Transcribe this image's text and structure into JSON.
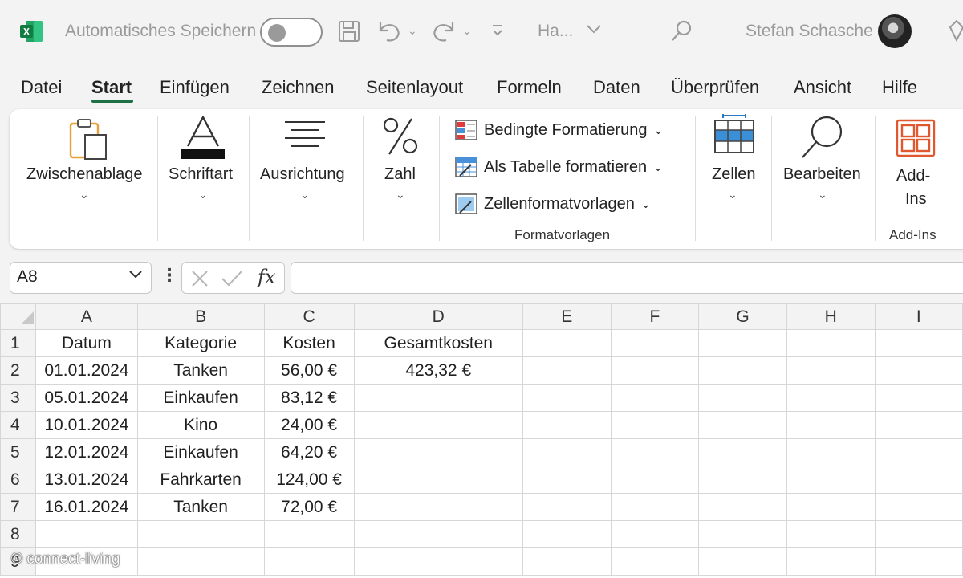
{
  "titlebar": {
    "autosave_label": "Automatisches Speichern",
    "doc_name": "Ha...",
    "user_name": "Stefan Schasche"
  },
  "tabs": [
    {
      "label": "Datei"
    },
    {
      "label": "Start"
    },
    {
      "label": "Einfügen"
    },
    {
      "label": "Zeichnen"
    },
    {
      "label": "Seitenlayout"
    },
    {
      "label": "Formeln"
    },
    {
      "label": "Daten"
    },
    {
      "label": "Überprüfen"
    },
    {
      "label": "Ansicht"
    },
    {
      "label": "Hilfe"
    }
  ],
  "ribbon": {
    "clipboard": "Zwischenablage",
    "font": "Schriftart",
    "alignment": "Ausrichtung",
    "number": "Zahl",
    "conditional_formatting": "Bedingte Formatierung",
    "format_as_table": "Als Tabelle formatieren",
    "cell_styles": "Zellenformatvorlagen",
    "styles_group": "Formatvorlagen",
    "cells": "Zellen",
    "editing": "Bearbeiten",
    "addins_line1": "Add-",
    "addins_line2": "Ins",
    "addins_group": "Add-Ins"
  },
  "formula_bar": {
    "name_box": "A8",
    "fx": "fx",
    "formula": ""
  },
  "sheet": {
    "columns": [
      "A",
      "B",
      "C",
      "D",
      "E",
      "F",
      "G",
      "H",
      "I"
    ],
    "rows": [
      {
        "num": "1",
        "cells": [
          "Datum",
          "Kategorie",
          "Kosten",
          "Gesamtkosten",
          "",
          "",
          "",
          "",
          ""
        ]
      },
      {
        "num": "2",
        "cells": [
          "01.01.2024",
          "Tanken",
          "56,00 €",
          "423,32 €",
          "",
          "",
          "",
          "",
          ""
        ]
      },
      {
        "num": "3",
        "cells": [
          "05.01.2024",
          "Einkaufen",
          "83,12 €",
          "",
          "",
          "",
          "",
          "",
          ""
        ]
      },
      {
        "num": "4",
        "cells": [
          "10.01.2024",
          "Kino",
          "24,00 €",
          "",
          "",
          "",
          "",
          "",
          ""
        ]
      },
      {
        "num": "5",
        "cells": [
          "12.01.2024",
          "Einkaufen",
          "64,20 €",
          "",
          "",
          "",
          "",
          "",
          ""
        ]
      },
      {
        "num": "6",
        "cells": [
          "13.01.2024",
          "Fahrkarten",
          "124,00 €",
          "",
          "",
          "",
          "",
          "",
          ""
        ]
      },
      {
        "num": "7",
        "cells": [
          "16.01.2024",
          "Tanken",
          "72,00 €",
          "",
          "",
          "",
          "",
          "",
          ""
        ]
      },
      {
        "num": "8",
        "cells": [
          "",
          "",
          "",
          "",
          "",
          "",
          "",
          "",
          ""
        ]
      },
      {
        "num": "9",
        "cells": [
          "",
          "",
          "",
          "",
          "",
          "",
          "",
          "",
          ""
        ]
      }
    ]
  },
  "watermark": "© connect-living",
  "colors": {
    "accent": "#1e7145",
    "ribbon_bg": "#ffffff",
    "chrome_bg": "#f3f3f3"
  }
}
